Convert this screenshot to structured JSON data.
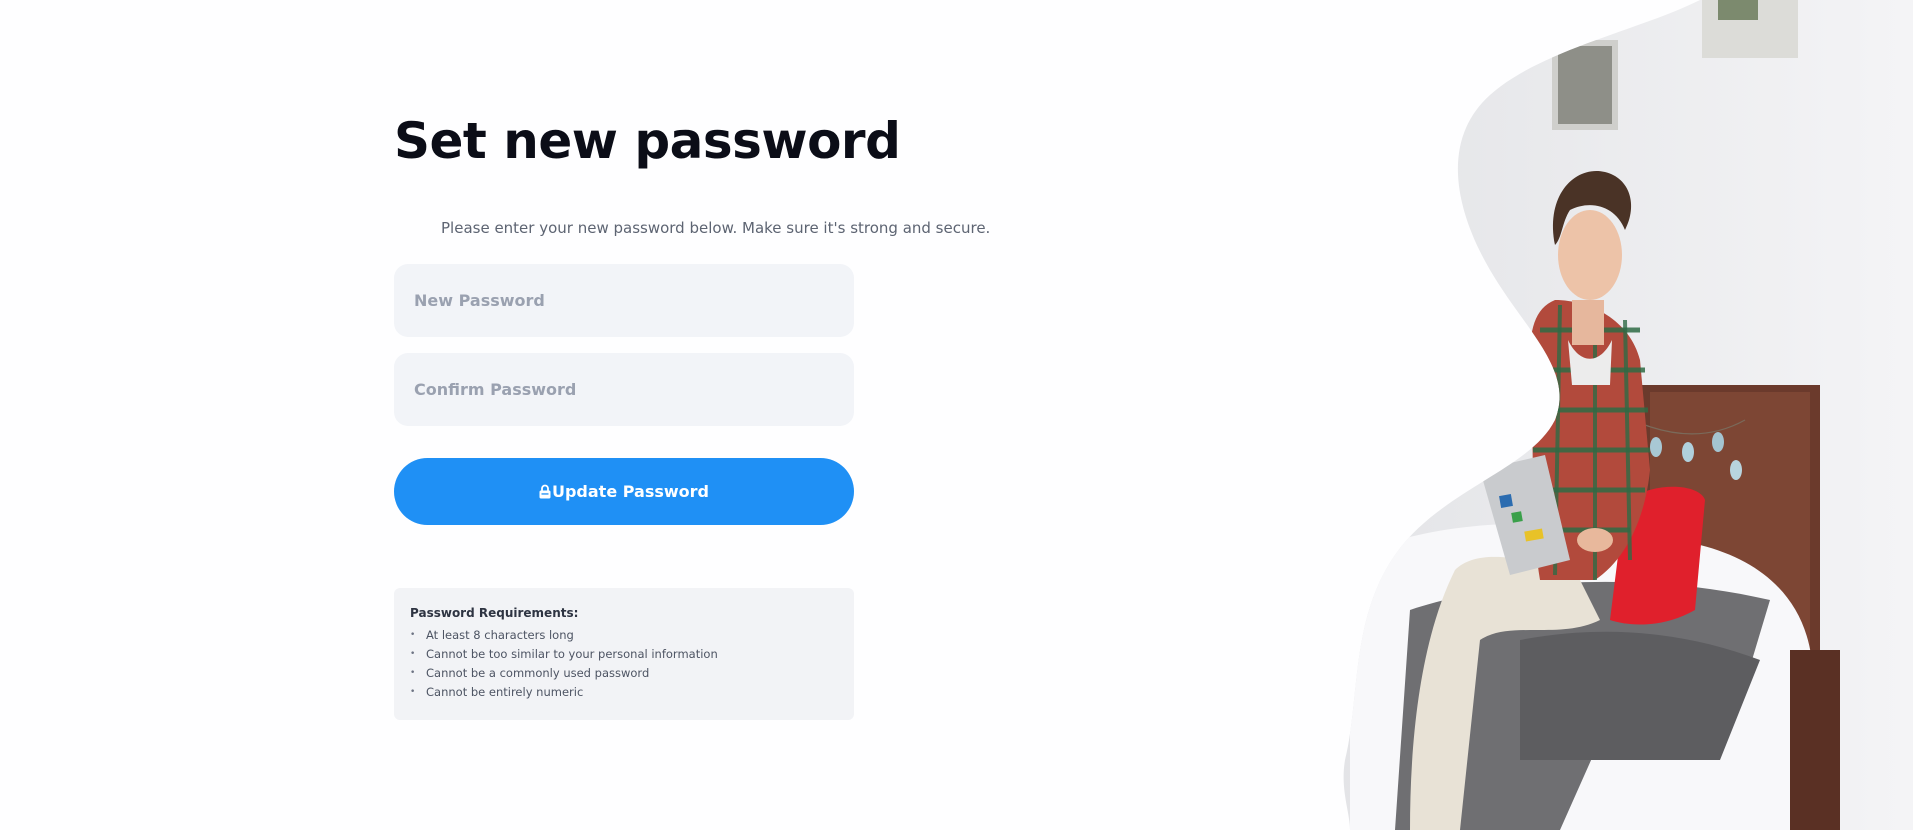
{
  "form": {
    "title": "Set new password",
    "subtitle": "Please enter your new password below. Make sure it's strong and secure.",
    "new_password_placeholder": "New Password",
    "confirm_password_placeholder": "Confirm Password",
    "submit_label": "Update Password",
    "submit_icon": "lock-icon"
  },
  "requirements": {
    "title": "Password Requirements:",
    "items": [
      "At least 8 characters long",
      "Cannot be too similar to your personal information",
      "Cannot be a commonly used password",
      "Cannot be entirely numeric"
    ]
  },
  "colors": {
    "accent": "#1f90f5",
    "field_bg": "#f2f4f8",
    "text_dark": "#0b0d17"
  }
}
